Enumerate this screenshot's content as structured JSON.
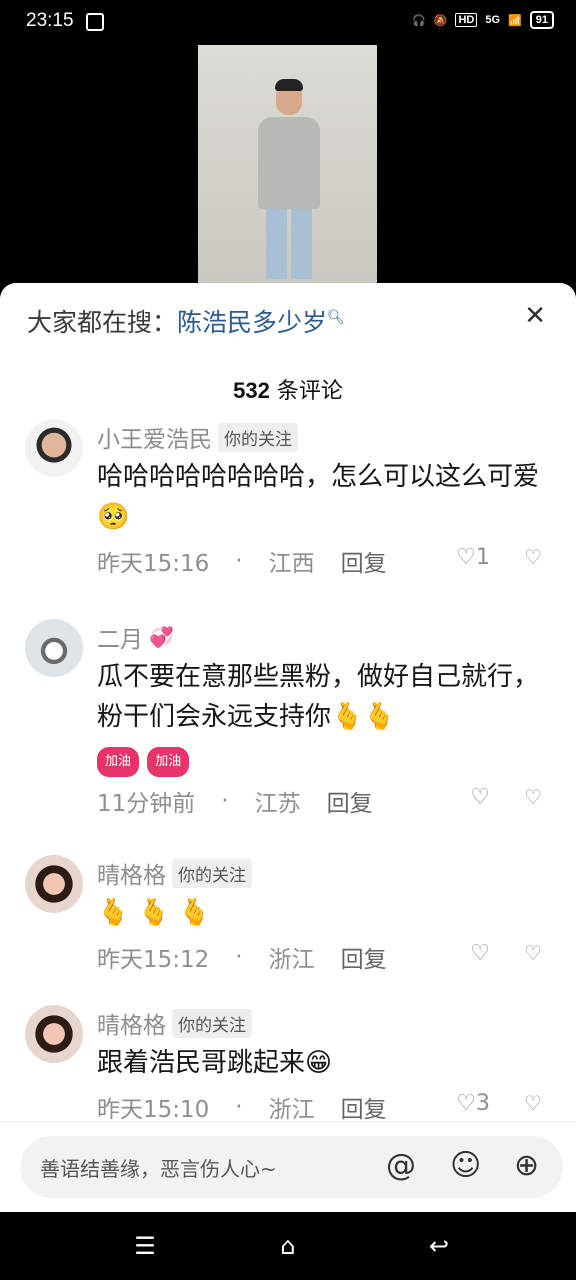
{
  "status_bar": {
    "time": "23:15",
    "network": "5G",
    "battery": "91"
  },
  "search": {
    "prefix": "大家都在搜：",
    "term": "陈浩民多少岁"
  },
  "comment_count": {
    "number": "532",
    "label": "条评论"
  },
  "comments": [
    {
      "name": "小王爱浩民",
      "tag": "你的关注",
      "text": "哈哈哈哈哈哈哈哈，怎么可以这么可爱",
      "emoji": "🥺",
      "time": "昨天15:16",
      "location": "江西",
      "reply": "回复",
      "likes": "1"
    },
    {
      "name": "二月",
      "name_emoji": "💞",
      "text": "瓜不要在意那些黑粉，做好自己就行，粉干们会永远支持你",
      "emoji": "🫰🫰",
      "stickers": [
        "加油",
        "加油"
      ],
      "time": "11分钟前",
      "location": "江苏",
      "reply": "回复",
      "likes": ""
    },
    {
      "name": "晴格格",
      "tag": "你的关注",
      "text": "",
      "emoji": "🫰 🫰 🫰",
      "time": "昨天15:12",
      "location": "浙江",
      "reply": "回复",
      "likes": ""
    },
    {
      "name": "晴格格",
      "tag": "你的关注",
      "text": "跟着浩民哥跳起来",
      "emoji": "😁",
      "time": "昨天15:10",
      "location": "浙江",
      "reply": "回复",
      "likes": "3"
    }
  ],
  "input": {
    "placeholder": "善语结善缘，恶言伤人心~"
  },
  "icons": {
    "close": "close-icon",
    "at": "at-icon",
    "emoji": "emoji-icon",
    "add": "add-icon",
    "like": "heart-icon",
    "dislike": "broken-heart-icon"
  }
}
